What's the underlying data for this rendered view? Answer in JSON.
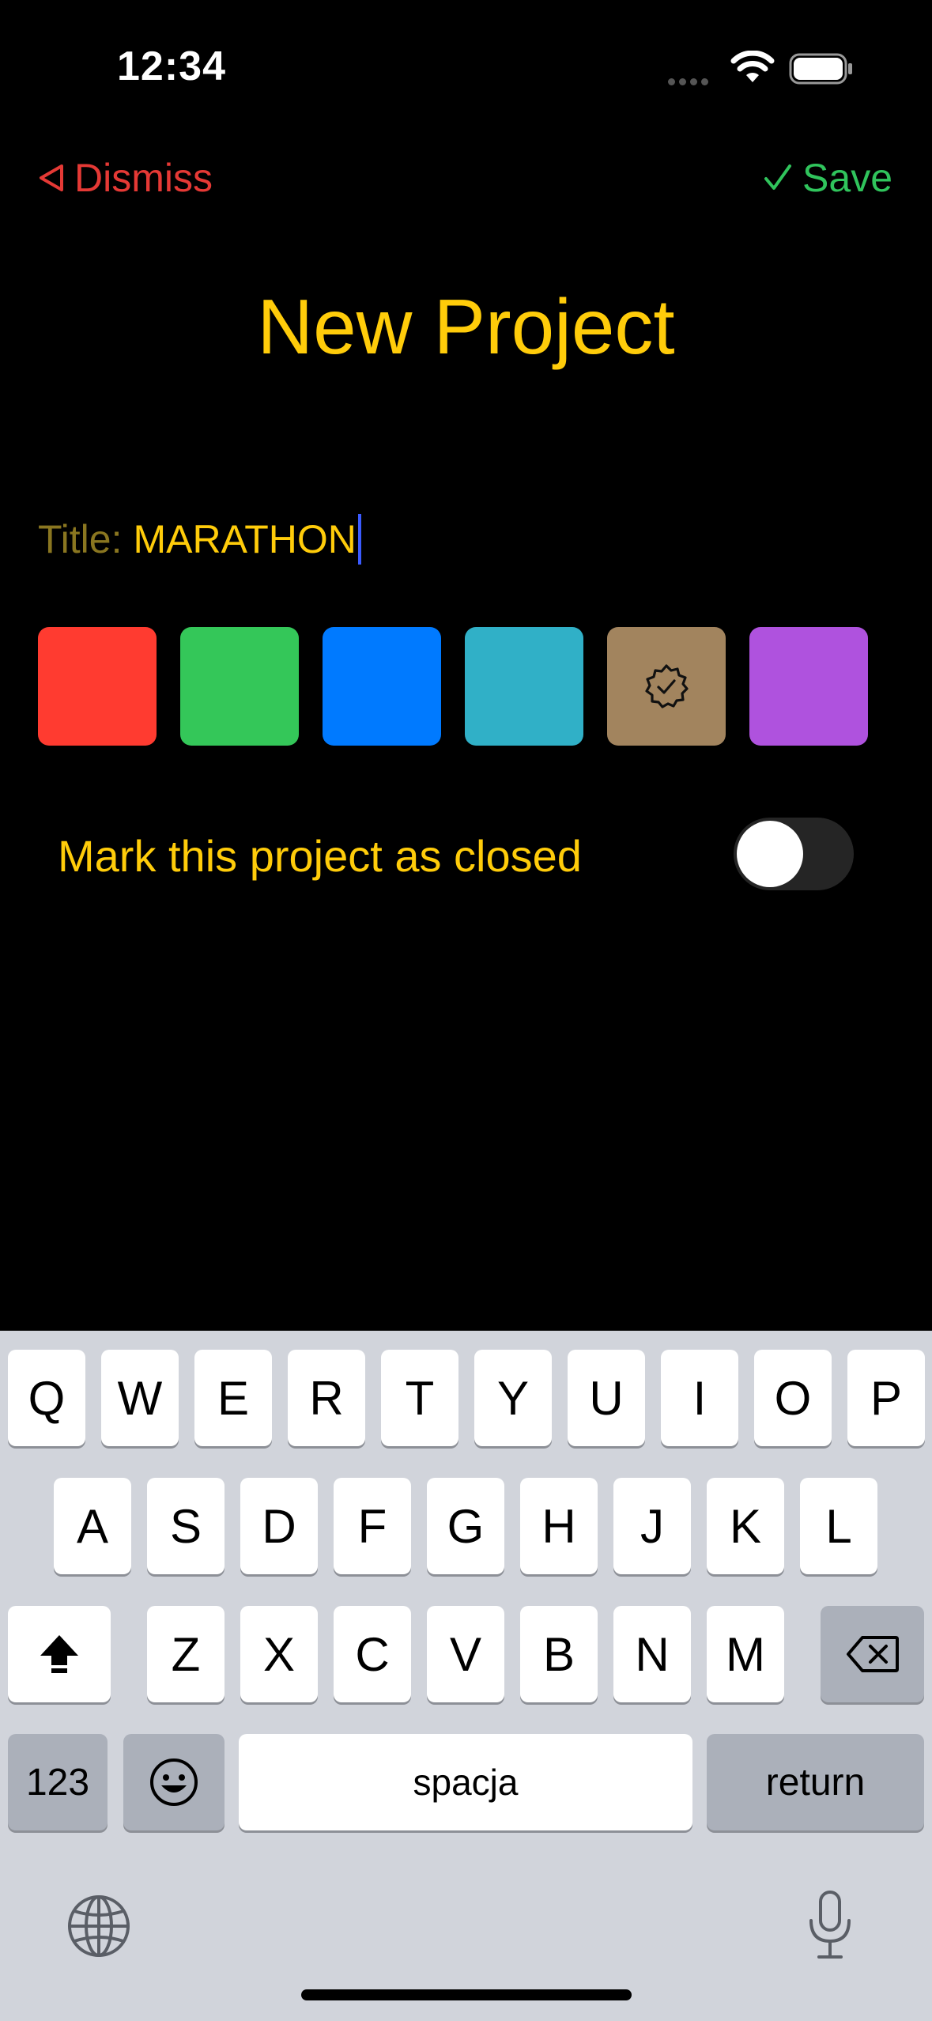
{
  "status": {
    "time": "12:34"
  },
  "nav": {
    "dismiss_label": "Dismiss",
    "save_label": "Save",
    "dismiss_icon": "triangle-left-icon",
    "save_icon": "checkmark-icon"
  },
  "page": {
    "title": "New Project"
  },
  "form": {
    "title_label": "Title:",
    "title_value": "MARATHON",
    "colors": [
      "#ff3b30",
      "#34c759",
      "#007aff",
      "#30b0c7",
      "#a2845e",
      "#af52de"
    ],
    "selected_color": "#a2845e",
    "toggle_label": "Mark this project as closed",
    "toggle_on": false
  },
  "keyboard": {
    "row1": [
      "Q",
      "W",
      "E",
      "R",
      "T",
      "Y",
      "U",
      "I",
      "O",
      "P"
    ],
    "row2": [
      "A",
      "S",
      "D",
      "F",
      "G",
      "H",
      "J",
      "K",
      "L"
    ],
    "row3": [
      "Z",
      "X",
      "C",
      "V",
      "B",
      "N",
      "M"
    ],
    "numbers_label": "123",
    "space_label": "spacja",
    "return_label": "return"
  }
}
